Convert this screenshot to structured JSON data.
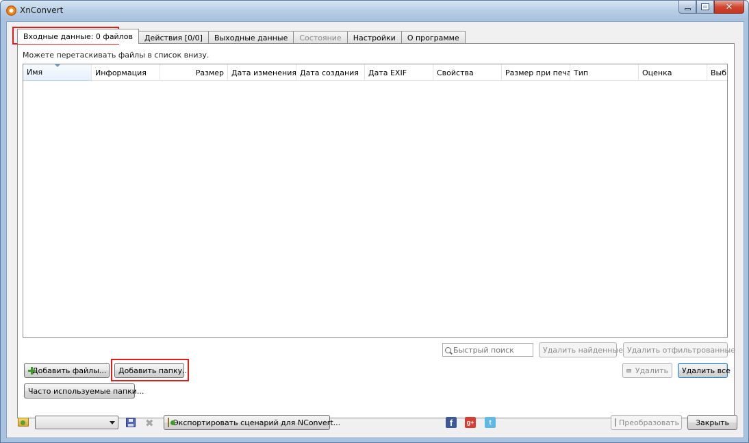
{
  "window": {
    "title": "XnConvert"
  },
  "tabs": [
    {
      "label": "Входные данные: 0 файлов",
      "state": "active"
    },
    {
      "label": "Действия [0/0]",
      "state": "normal"
    },
    {
      "label": "Выходные данные",
      "state": "normal"
    },
    {
      "label": "Состояние",
      "state": "disabled"
    },
    {
      "label": "Настройки",
      "state": "normal"
    },
    {
      "label": "О программе",
      "state": "normal"
    }
  ],
  "input": {
    "hint": "Можете перетаскивать файлы в список внизу.",
    "columns": [
      "Имя",
      "Информация",
      "Размер",
      "Дата изменения",
      "Дата создания",
      "Дата EXIF",
      "Свойства",
      "Размер при печа",
      "Тип",
      "Оценка",
      "Выб"
    ],
    "rows": [],
    "search_placeholder": "Быстрый поиск",
    "remove_found_label": "Удалить найденные",
    "remove_filtered_label": "Удалить отфильтрованные",
    "add_files_label": "Добавить файлы...",
    "add_folder_label": "Добавить папку...",
    "frequent_folders_label": "Часто используемые папки...",
    "remove_label": "Удалить",
    "remove_all_label": "Удалить все"
  },
  "footer": {
    "preset_value": "",
    "export_label": "Экспортировать сценарий для NConvert...",
    "convert_label": "Преобразовать",
    "close_label": "Закрыть"
  },
  "colors": {
    "highlight": "#e21b1b",
    "facebook": "#3b5998",
    "google_plus": "#d73d32",
    "twitter": "#5eb9e8"
  }
}
